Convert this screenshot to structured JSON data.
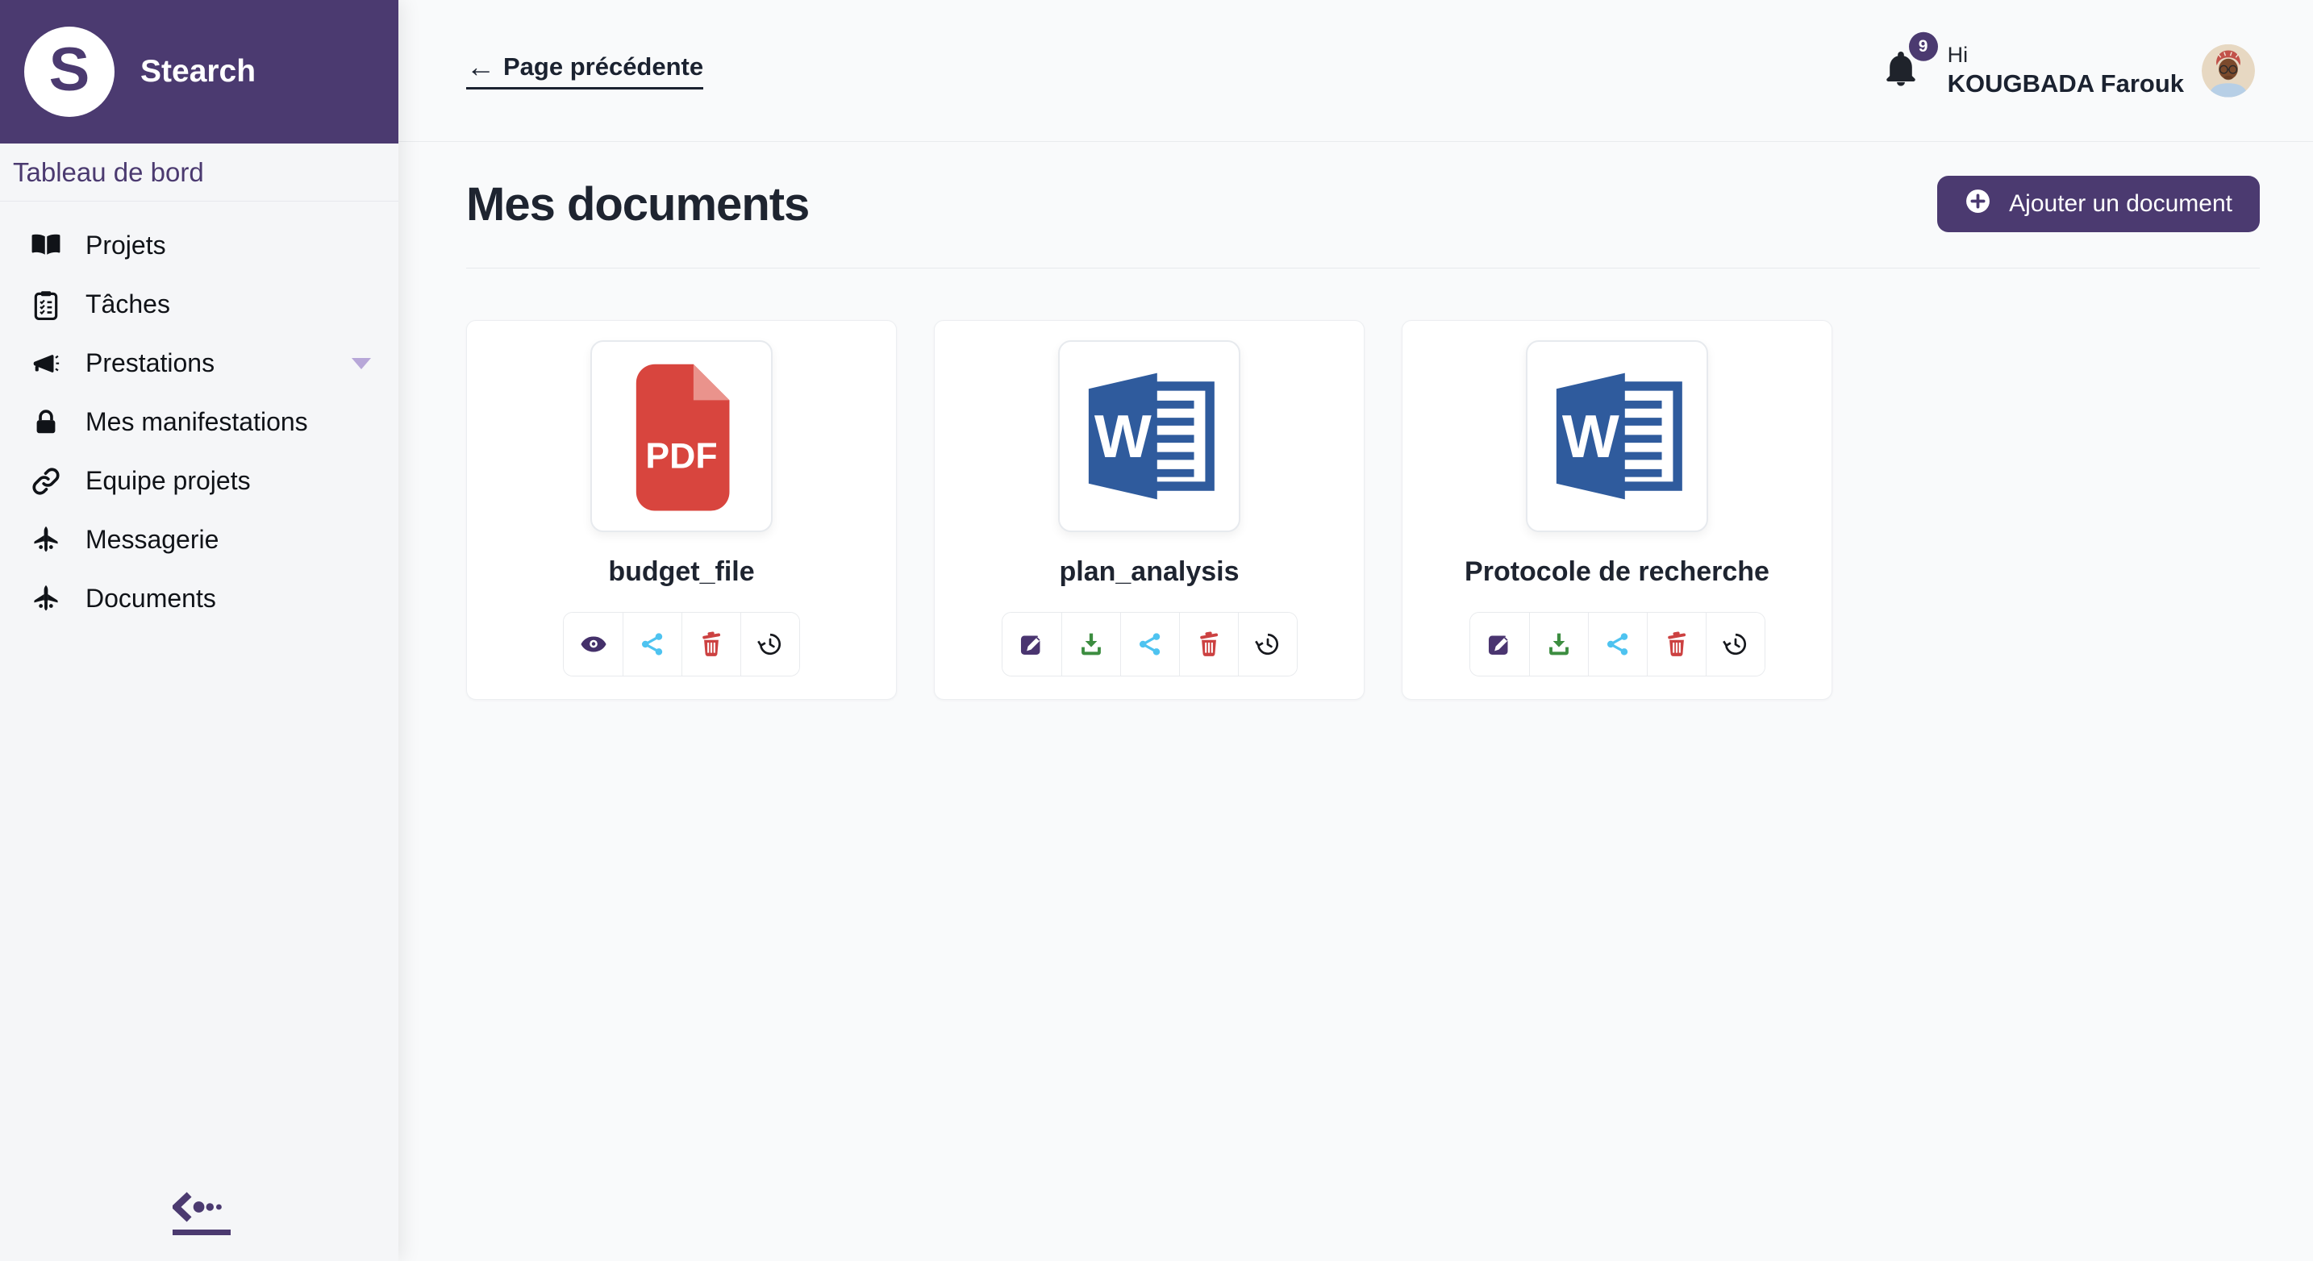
{
  "sidebar": {
    "brand": "Stearch",
    "dashboard_label": "Tableau de bord",
    "items": [
      {
        "label": "Projets",
        "icon": "book-open-icon"
      },
      {
        "label": "Tâches",
        "icon": "clipboard-list-icon"
      },
      {
        "label": "Prestations",
        "icon": "megaphone-icon",
        "has_caret": true
      },
      {
        "label": "Mes manifestations",
        "icon": "lock-icon"
      },
      {
        "label": "Equipe projets",
        "icon": "link-icon"
      },
      {
        "label": "Messagerie",
        "icon": "jet-up-icon"
      },
      {
        "label": "Documents",
        "icon": "jet-up-icon"
      }
    ]
  },
  "header": {
    "back_link": "Page précédente",
    "notification_count": "9",
    "greeting": "Hi",
    "user_name": "KOUGBADA Farouk"
  },
  "main": {
    "title": "Mes documents",
    "add_button_label": "Ajouter un document",
    "documents": [
      {
        "name": "budget_file",
        "type": "pdf",
        "actions": [
          "view",
          "share",
          "delete",
          "history"
        ]
      },
      {
        "name": "plan_analysis",
        "type": "word",
        "actions": [
          "edit",
          "download",
          "share",
          "delete",
          "history"
        ]
      },
      {
        "name": "Protocole de recherche",
        "type": "word",
        "actions": [
          "edit",
          "download",
          "share",
          "delete",
          "history"
        ]
      }
    ]
  },
  "colors": {
    "primary_purple": "#4b3a70",
    "eye_purple": "#44306a",
    "edit_purple": "#4a3570",
    "share_cyan": "#4ec3f0",
    "trash_red": "#cc4141",
    "download_green": "#3c8d40",
    "word_blue": "#2f5b9d",
    "pdf_red": "#d8453e",
    "pdf_fold": "#ea938c",
    "sidebar_bg": "#f5f6f8",
    "main_bg": "#f9fafb"
  }
}
